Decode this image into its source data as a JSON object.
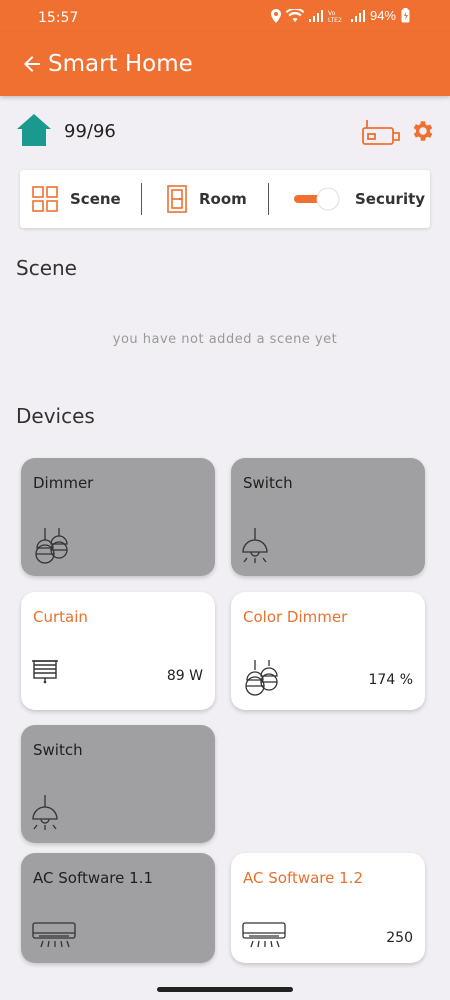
{
  "status_bar": {
    "time": "15:57",
    "battery": "94%"
  },
  "header": {
    "title": "Smart Home"
  },
  "info": {
    "home_count": "99/96"
  },
  "tabs": [
    {
      "label": "Scene"
    },
    {
      "label": "Room"
    },
    {
      "label": "Security"
    }
  ],
  "scene_section": {
    "title": "Scene",
    "empty_text": "you have not added a scene yet"
  },
  "devices_section": {
    "title": "Devices"
  },
  "devices": [
    {
      "name": "Dimmer",
      "state": "off",
      "icon": "dimmer-lamps-icon",
      "value": ""
    },
    {
      "name": "Switch",
      "state": "off",
      "icon": "pendant-lamp-icon",
      "value": ""
    },
    {
      "name": "Curtain",
      "state": "on",
      "icon": "blind-icon",
      "value": "89 W"
    },
    {
      "name": "Color Dimmer",
      "state": "on",
      "icon": "dimmer-lamps-icon",
      "value": "174 %"
    },
    {
      "name": "Switch",
      "state": "off",
      "icon": "pendant-lamp-icon",
      "value": ""
    },
    {
      "name": "AC Software 1.1",
      "state": "off",
      "icon": "air-conditioner-icon",
      "value": ""
    },
    {
      "name": "AC Software 1.2",
      "state": "on",
      "icon": "air-conditioner-icon",
      "value": "250"
    }
  ],
  "colors": {
    "accent": "#ef7030",
    "home_icon": "#1a9a8e",
    "card_off": "#a0a0a2",
    "card_on": "#ffffff"
  }
}
